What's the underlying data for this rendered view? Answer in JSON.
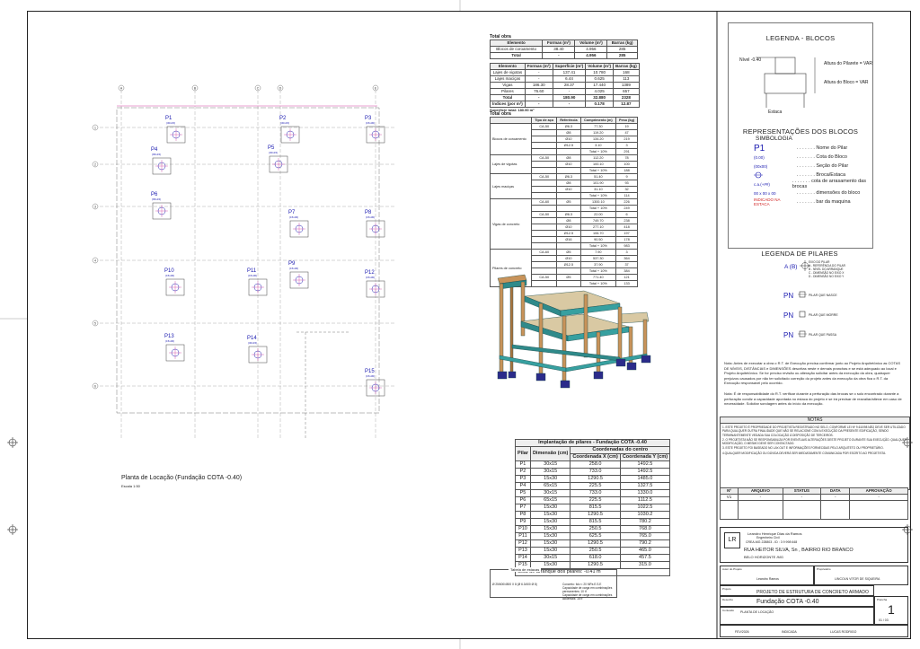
{
  "plan": {
    "title": "Planta de Locação (Fundação COTA -0.40)",
    "scale": "Escala 1:50",
    "axes": [
      "A",
      "B",
      "C",
      "D",
      "E"
    ],
    "rows": [
      "1",
      "2",
      "3",
      "4",
      "5",
      "6"
    ],
    "pillars": [
      {
        "name": "P1",
        "sub": "(30x15)"
      },
      {
        "name": "P2",
        "sub": "(30x15)"
      },
      {
        "name": "P3",
        "sub": "(15x30)"
      },
      {
        "name": "P4",
        "sub": "(65x15)"
      },
      {
        "name": "P5",
        "sub": "(30x15)"
      },
      {
        "name": "P6",
        "sub": "(65x15)"
      },
      {
        "name": "P7",
        "sub": "(15x30)"
      },
      {
        "name": "P8",
        "sub": "(15x30)"
      },
      {
        "name": "P9",
        "sub": "(15x30)"
      },
      {
        "name": "P10",
        "sub": "(15x30)"
      },
      {
        "name": "P11",
        "sub": "(15x30)"
      },
      {
        "name": "P12",
        "sub": "(15x30)"
      },
      {
        "name": "P13",
        "sub": "(15x30)"
      },
      {
        "name": "P14",
        "sub": "(30x15)"
      },
      {
        "name": "P15",
        "sub": "(15x30)"
      }
    ]
  },
  "totals1": {
    "title": "Total obra",
    "headers": [
      "Elemento",
      "Formas (m²)",
      "Volume (m³)",
      "Barras (kg)"
    ],
    "rows": [
      [
        "Blocos de coroamento",
        "38.40",
        "4.956",
        "285"
      ]
    ],
    "total": [
      "Total",
      "-",
      "4.956",
      "285"
    ]
  },
  "totals2": {
    "headers": [
      "Elemento",
      "Formas (m²)",
      "Superfície (m²)",
      "Volume (m³)",
      "Barras (kg)"
    ],
    "rows": [
      [
        "Lajes de vigotas",
        "-",
        "137.41",
        "10.780",
        "168"
      ],
      [
        "Lajes maciças",
        "-",
        "6.44",
        "0.625",
        "113"
      ],
      [
        "Vigas",
        "186.30",
        "28.37",
        "17.440",
        "1389"
      ],
      [
        "Pilares",
        "76.60",
        "-",
        "4.025",
        "657"
      ]
    ],
    "total": [
      "Total",
      "-",
      "180.90",
      "32.880",
      "2328"
    ],
    "ratio": [
      "Índices (por m²)",
      "-",
      "-",
      "0.178",
      "12.87"
    ],
    "area": "Superfície total: 180.90 m²"
  },
  "steel": {
    "title": "Total obra",
    "headers": [
      "",
      "Tipo de aço",
      "Referência",
      "Comprimento (m)",
      "Peso (kg)"
    ],
    "groups": [
      {
        "name": "Blocos de coroamento",
        "lines": [
          [
            "CA-50",
            "Ø6.3",
            "77.30",
            "19"
          ],
          [
            "",
            "Ø8",
            "119.20",
            "47"
          ],
          [
            "",
            "Ø10",
            "134.20",
            "219"
          ],
          [
            "",
            "Ø12.5",
            "3.10",
            "3"
          ],
          [
            "",
            "",
            "Total + 10%",
            "291"
          ]
        ]
      },
      {
        "name": "Lajes de vigotas",
        "lines": [
          [
            "CA-50",
            "Ø8",
            "112.20",
            "78"
          ],
          [
            "",
            "Ø10",
            "100.10",
            "100"
          ],
          [
            "",
            "",
            "Total + 10%",
            "188"
          ]
        ]
      },
      {
        "name": "Lajes maciças",
        "lines": [
          [
            "CA-50",
            "Ø6.3",
            "51.40",
            "9"
          ],
          [
            "",
            "Ø8",
            "101.90",
            "93"
          ],
          [
            "",
            "Ø10",
            "31.10",
            "32"
          ],
          [
            "",
            "",
            "Total + 10%",
            "114"
          ]
        ]
      },
      {
        "name": "Vigas de concreto",
        "lines": [
          [
            "CA-60",
            "Ø5",
            "1300.10",
            "226"
          ],
          [
            "",
            "",
            "Total + 10%",
            "249"
          ],
          [
            "CA-50",
            "Ø6.3",
            "22.00",
            "6"
          ],
          [
            "",
            "Ø8",
            "749.70",
            "238"
          ],
          [
            "",
            "Ø10",
            "277.10",
            "418"
          ],
          [
            "",
            "Ø12.5",
            "106.70",
            "197"
          ],
          [
            "",
            "Ø16",
            "90.50",
            "178"
          ],
          [
            "",
            "",
            "Total + 10%",
            "983"
          ]
        ]
      },
      {
        "name": "Pilares de concreto",
        "lines": [
          [
            "CA-60",
            "Ø5",
            "7.90",
            "3"
          ],
          [
            "",
            "Ø10",
            "537.30",
            "364"
          ],
          [
            "",
            "Ø12.5",
            "37.90",
            "37"
          ],
          [
            "",
            "",
            "Total + 10%",
            "384"
          ],
          [
            "CA-50",
            "Ø5",
            "771.40",
            "121"
          ],
          [
            "",
            "",
            "Total + 10%",
            "133"
          ]
        ]
      }
    ]
  },
  "implant": {
    "title": "Implantação de pilares - Fundação COTA -0.40",
    "headers": [
      "Pilar",
      "Dimensão (cm)",
      "Coordenada X (cm)",
      "Coordenada Y (cm)"
    ],
    "coord_header": "Coordenadas do centro",
    "rows": [
      [
        "P1",
        "30x15",
        "258.0",
        "1492.5"
      ],
      [
        "P2",
        "30x15",
        "733.0",
        "1492.5"
      ],
      [
        "P3",
        "15x30",
        "1290.5",
        "1485.0"
      ],
      [
        "P4",
        "65x15",
        "225.5",
        "1327.5"
      ],
      [
        "P5",
        "30x15",
        "733.0",
        "1330.0"
      ],
      [
        "P6",
        "65x15",
        "225.5",
        "1112.5"
      ],
      [
        "P7",
        "15x30",
        "815.5",
        "1022.5"
      ],
      [
        "P8",
        "15x30",
        "1290.5",
        "1030.2"
      ],
      [
        "P9",
        "15x30",
        "815.5",
        "780.2"
      ],
      [
        "P10",
        "15x30",
        "250.5",
        "768.0"
      ],
      [
        "P11",
        "15x30",
        "625.5",
        "765.0"
      ],
      [
        "P12",
        "15x30",
        "1290.5",
        "790.2"
      ],
      [
        "P13",
        "15x30",
        "250.5",
        "465.0"
      ],
      [
        "P14",
        "30x15",
        "618.0",
        "457.5"
      ],
      [
        "P15",
        "15x30",
        "1290.5",
        "315.0"
      ]
    ],
    "footer": "Cota de arranque dos pilares: -0.41 m"
  },
  "legend_blocks": {
    "title": "LEGENDA - BLOCOS",
    "level": "Nível -0.40",
    "pilar_height": "Altura do Pilarete = VAR",
    "block_height": "Altura do Bloco = VAR",
    "stake": "Estaca",
    "rep_title": "REPRESENTAÇÕES  DOS  BLOCOS",
    "symb_title": "SIMBOLOGIA",
    "items": [
      {
        "sym": "P1",
        "text": "Nome do Pilar"
      },
      {
        "sym": "(0.00)",
        "text": "Cota do Bloco"
      },
      {
        "sym": "(00x00)",
        "text": "Seção do Pilar"
      },
      {
        "sym": "",
        "text": "Broca/Estaca"
      },
      {
        "sym": "c.a.(+##)",
        "text": "cota de arrasamento das brocas"
      },
      {
        "sym": "00 x 00 x 00",
        "text": "dimensões do bloco"
      },
      {
        "sym": "INDICADO NA ESTACA",
        "text": "bar da maquina"
      }
    ]
  },
  "legend_pillars": {
    "title": "LEGENDA DE PILARES",
    "axis_label": "A (B)",
    "axis_lines": [
      "EIXO DO PILAR",
      "A - REFERÊNCIA DO PILAR",
      "B - NÍVEL DO ARRANQUE",
      "C - DIMENSÃO NO EIXO X",
      "D - DIMENSÃO NO EIXO Y"
    ],
    "types": [
      {
        "sym": "PN",
        "text": "PILAR QUE NASCE"
      },
      {
        "sym": "PN",
        "text": "PILAR QUE MORRE"
      },
      {
        "sym": "PN",
        "text": "PILAR QUE PASSA"
      }
    ]
  },
  "note1": "Nota: Antes de executar a obra o R.T. de Execução precisa confirmar junto ao Projeto Arquitetônico as COTAS DE NÍVEIS, DISTÂNCIAS e DIMENSÕES descritas neste e demais pranchas e se está adequado ao local e Projeto Arquitetônico. Se for preciso revisão ou alteração solicitar antes da execução da obra, quaisquer prejuízos causados por não ter solicitado correção do projeto antes da execução da obra fica o R.T. da Execução responsável pelo ocorrido.",
  "note2": "Nota: É de responsabilidade do R.T. verificar durante a perfuração das brocas se o solo encontrado durante a perfuração condiz a capacidade apontada no estaca do projeto e se irá precisar de reavaliar/alterar em caso de necessidade. Solicitar sondagem antes do início da execução.",
  "notes": {
    "title": "NOTAS",
    "lines": [
      "1. ESTE PROJETO É PROPRIEDADE DO PROJETISTA REGISTRADO NO SELO, CONFORME LEI Nº 9.610/98 NÃO DEVE SER UTILIZADO PARA QUALQUER OUTRA FINALIDADE QUE NÃO SE RELACIONE COM A EXECUÇÃO DA PRESENTE EDIFICAÇÃO, SENDO TERMINANTEMENTE VEDADA SUA COLOCAÇÃO À DISPOSIÇÃO DE TERCEIROS.",
      "2. O PROJETISTA NÃO SE RESPONSABILIZA POR EVENTUAIS ALTERAÇÕES DESTE PROJETO DURANTE SUA EXECUÇÃO. QUALQUER MODIFICAÇÃO, O MESMO DEVE SER CONTACTADO.",
      "3. ESTE PROJETO FOI BASEADO NO LAY-OUT E INFORMAÇÕES FORNECIDAS PELO ARQUITETO OU PROPRIETÁRIO.",
      "4.QUALQUER MODIFICAÇÃO OU DÚVIDA DEVERÁ SER IMEDIATAMENTE COMUNICADA POR ESCRITO AO PROJETISTA."
    ]
  },
  "revisions": {
    "headers": [
      "Nº",
      "ARQUIVO",
      "STATUS",
      "DATA",
      "APROVAÇÃO"
    ],
    "row": [
      "V1",
      "-",
      "-",
      "-",
      "-"
    ]
  },
  "title_block": {
    "engineer": "Leandro Henrique Dias da Ramos",
    "role": "Engenheiro Civil",
    "crea": "CREA-MG 228803 - ID : 3 9 998 648",
    "address": "RUA HEITOR SILVA, Sn , BAIRRO RIO BRANCO",
    "city": "BELO HORIZONTE /MG",
    "author_label": "Autor do Projeto",
    "author_name": "Leandro Ramos",
    "owner_label": "Proprietário",
    "owner_name": "LINCOLN VITOR DE SIQUEIRA",
    "project_label": "Projeto",
    "project": "PROJETO DE ESTRUTURA DE CONCRETO ARMADO",
    "content_label": "Conteúdo",
    "content": "PLANTA DE LOCAÇÃO",
    "drawing_label": "Desenho",
    "drawing": "Fundação COTA -0.40",
    "sheet_label": "Prancha",
    "sheet": "1",
    "date": "FEV/2026",
    "scale": "INDICADA",
    "drawn_by": "LUCAS RODRIGO",
    "sheet_of": "01 / 03"
  },
  "sample_table": {
    "title": "Tabela de estacas",
    "lines": [
      "Concreto: fck>= 20 MPa E.S.E",
      "Capacidade de carga em combinações permanentes: 10 tf",
      "Capacidade de carga em combinações acidentais: 16 tf"
    ],
    "left": "Ø 25/600/4500 X 8 (Ø 6.3/400 Ø 8)"
  }
}
